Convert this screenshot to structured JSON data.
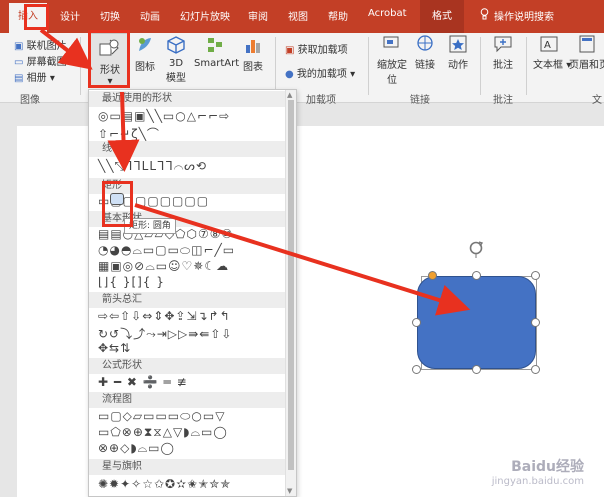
{
  "tabs": {
    "insert": "插入",
    "design": "设计",
    "transitions": "切换",
    "animations": "动画",
    "slideshow": "幻灯片放映",
    "review": "审阅",
    "view": "视图",
    "help": "帮助",
    "acrobat": "Acrobat",
    "format": "格式",
    "tell_me": "操作说明搜索"
  },
  "ribbon": {
    "online_pictures": "联机图片",
    "screenshot": "屏幕截图",
    "album": "相册",
    "images_group": "图像",
    "shapes": "形状",
    "icons": "图标",
    "model_3d_line1": "3D",
    "model_3d_line2": "模型",
    "smartart": "SmartArt",
    "chart": "图表",
    "get_addins": "获取加载项",
    "my_addins": "我的加载项",
    "addins_group": "加载项",
    "zoom_line1": "缩放定",
    "zoom_line2": "位",
    "link": "链接",
    "action": "动作",
    "links_group": "链接",
    "comment": "批注",
    "comments_group": "批注",
    "textbox": "文本框",
    "header_footer": "页眉和页脚",
    "text_group": "文"
  },
  "dropdown": {
    "recent": "最近使用的形状",
    "lines": "线条",
    "rectangles": "矩形",
    "basic": "基本形状",
    "arrows": "箭头总汇",
    "equation": "公式形状",
    "flowchart": "流程图",
    "stars": "星与旗帜",
    "rows": {
      "recent1": "◎▭▤▣╲╲▭○△⌐⌐⇨",
      "recent2": "⇧⌐↵ζ╲⌒",
      "lines1": "╲╲⤡ᒣᒣᒪᒪᒣᒣ⌒ᔕ⟲",
      "rect1": "▭▢▢▢▢▢▢▢▢",
      "basic1": "▤▤○△▱▱◇⬠⬡⑦⑧⑩",
      "basic2": "◔◕◓⌓▭▢▭⬭◫⌐╱▭",
      "basic3": "▦▣◎⊘⌓▭☺♡✵☾☁",
      "basic4": "⌊⌋{ }[]{ }",
      "arrows1": "⇨⇦⇧⇩⇔⇕✥⇪⇲↴↱↰",
      "arrows2": "↻↺⤵⤴⤳⇥▷▷⇛⇚⇧⇩",
      "arrows3": "✥⇆⇅",
      "equation1": "✚ ━ ✖ ➗ ═ ≢",
      "flow1": "▭▢◇▱▭▭▭⬭○▭▽",
      "flow2": "▭⬠⊗⊕⧗⧖△▽◗⌓▭◯",
      "flow3": "⊗⊕◇◗⌓▭◯",
      "stars1": "✺✹✦✧☆✩✪✫✬✭✮✯"
    }
  },
  "tooltip": "矩形: 圆角",
  "watermark": {
    "brand": "Baidu经验",
    "url": "jingyan.baidu.com"
  },
  "colors": {
    "accent": "#c33f26",
    "shape_fill": "#4472c4",
    "annotation": "#e8311f"
  }
}
